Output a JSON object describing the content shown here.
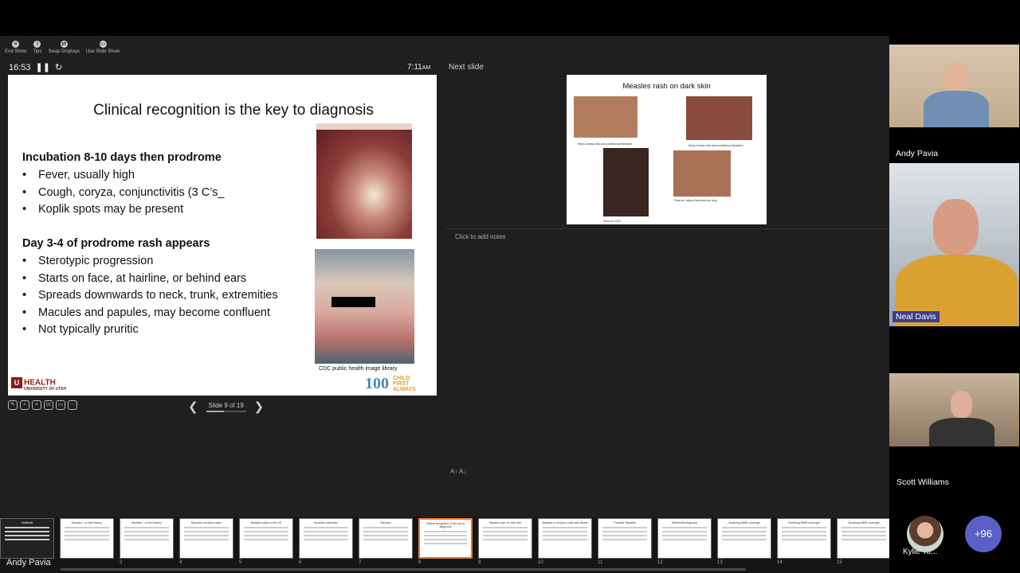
{
  "toolbar": {
    "end_show": "End Show",
    "tips": "Tips",
    "swap_displays": "Swap Displays",
    "use_slide_show": "Use Slide Show"
  },
  "timer": "16:53",
  "clock": {
    "time": "7:11",
    "ampm": "AM"
  },
  "next_slide_label": "Next slide",
  "slide": {
    "title": "Clinical recognition is the key to diagnosis",
    "section1": "Incubation 8-10 days then prodrome",
    "bullets1": [
      "Fever, usually high",
      "Cough, coryza, conjunctivitis (3 C’s_",
      "Koplik spots may be present"
    ],
    "section2": "Day 3-4 of prodrome rash appears",
    "bullets2": [
      "Sterotypic progression",
      "Starts on face, at hairline, or behind ears",
      "Spreads downwards to neck, trunk, extremities",
      "Macules and papules, may become confluent",
      "Not typically pruritic"
    ],
    "caption": "CDC public health image library",
    "logo_left": "HEALTH",
    "logo_left_sub": "UNIVERSITY OF UTAH",
    "logo_right_num": "100",
    "logo_right_text": "CHILD FIRST ALWAYS"
  },
  "slide_nav": {
    "label": "Slide 9 of 19"
  },
  "next_slide": {
    "title": "Measles rash on dark skin",
    "cap1": "https://www.nhs.uk/conditions/measles",
    "cap2": "https://www.nhs.uk/conditions/measles",
    "cap3": "Source CDC",
    "cap4": "Source: https://dermnetnz.org/"
  },
  "notes_placeholder": "Click to add notes",
  "thumbnails": [
    {
      "num": "",
      "title": "Outbreak"
    },
    {
      "num": "3",
      "title": "Measles – a brief history"
    },
    {
      "num": "4",
      "title": "Measles – a brief history"
    },
    {
      "num": "5",
      "title": "Reported measles cases"
    },
    {
      "num": "6",
      "title": "Measles cases in the US"
    },
    {
      "num": "7",
      "title": "Measles outbreaks"
    },
    {
      "num": "8",
      "title": "Measles"
    },
    {
      "num": "9",
      "title": "Clinical recognition is the key to diagnosis"
    },
    {
      "num": "10",
      "title": "Measles rash on dark skin"
    },
    {
      "num": "11",
      "title": "Measles is not just a mild rash illness"
    },
    {
      "num": "12",
      "title": "Possible Measles"
    },
    {
      "num": "13",
      "title": "Differential diagnosis"
    },
    {
      "num": "14",
      "title": "Declining MMR coverage"
    },
    {
      "num": "15",
      "title": "Declining MMR coverage"
    },
    {
      "num": "16",
      "title": "Declining MMR coverage"
    }
  ],
  "participants": [
    {
      "name": "Andy Pavia"
    },
    {
      "name": "Neal Davis"
    },
    {
      "name": "Scott Williams"
    },
    {
      "name": "Kylie To..."
    }
  ],
  "more_participants": "+96",
  "status_name": "Andy Pavia",
  "colors": {
    "accent_thumb": "#e8762a",
    "badge": "#3a3f8f",
    "more": "#5b5fc7",
    "utah_red": "#8b1a1a"
  }
}
